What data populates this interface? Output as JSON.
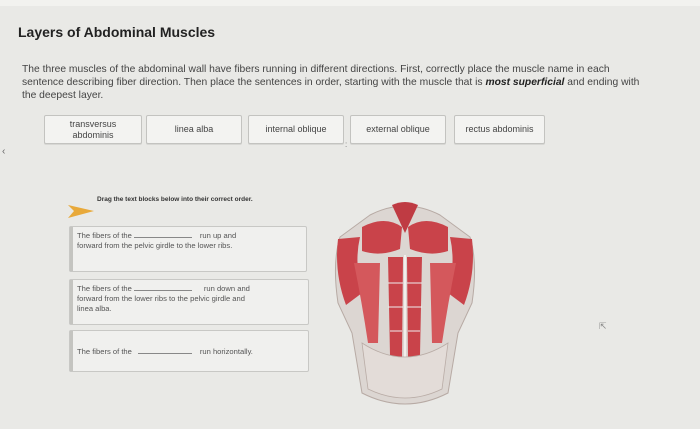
{
  "title": "Layers of Abdominal Muscles",
  "instructions": {
    "part1": "The three muscles of the abdominal wall have fibers running in different directions. First, correctly place the muscle name in each sentence describing fiber direction. Then place the sentences in order, starting with the muscle that is ",
    "emphasis": "most superficial",
    "part2": " and ending with the deepest layer."
  },
  "word_bank": [
    "transversus abdominis",
    "linea alba",
    "internal oblique",
    "external oblique",
    "rectus abdominis"
  ],
  "drag_prompt": "Drag the text blocks below into their correct order.",
  "sentences": [
    {
      "start": "The fibers of the",
      "end": "run up and",
      "line2": "forward from the pelvic girdle to the lower ribs."
    },
    {
      "start": "The fibers of the",
      "end": "run down and",
      "line2": "forward from the lower ribs to the pelvic girdle and",
      "line3": "linea alba."
    },
    {
      "start": "The fibers of the",
      "end": "run horizontally."
    }
  ],
  "side_arrow": "‹",
  "colors": {
    "muscle": "#c9434a",
    "fascia": "#dcd6d2",
    "background": "#e9e9e6"
  }
}
